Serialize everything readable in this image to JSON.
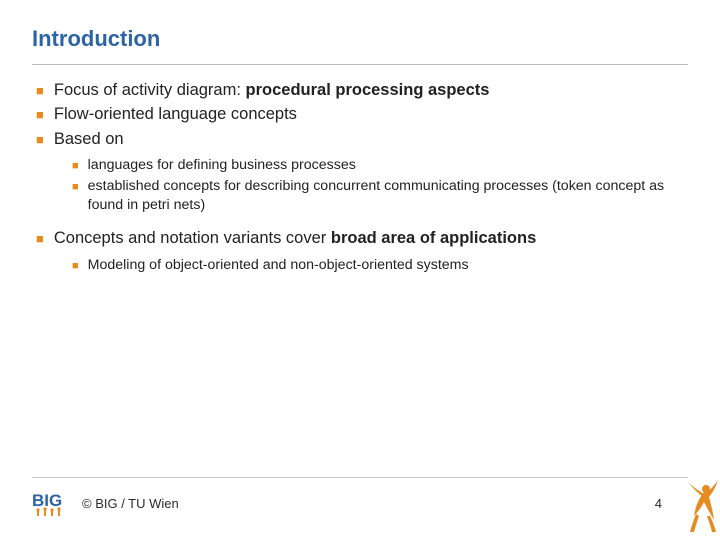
{
  "title": "Introduction",
  "bullets": {
    "b1_pre": "Focus of activity diagram: ",
    "b1_bold": "procedural processing aspects",
    "b2": "Flow-oriented language concepts",
    "b3": "Based on",
    "b3_sub1": "languages for defining business processes",
    "b3_sub2": "established concepts for describing concurrent communicating processes (token concept as found in petri nets)",
    "b4_pre": "Concepts and notation variants cover ",
    "b4_bold": "broad area of applications",
    "b4_sub1": "Modeling of object-oriented and non-object-oriented systems"
  },
  "footer": {
    "copyright": "© BIG / TU Wien",
    "page": "4"
  }
}
